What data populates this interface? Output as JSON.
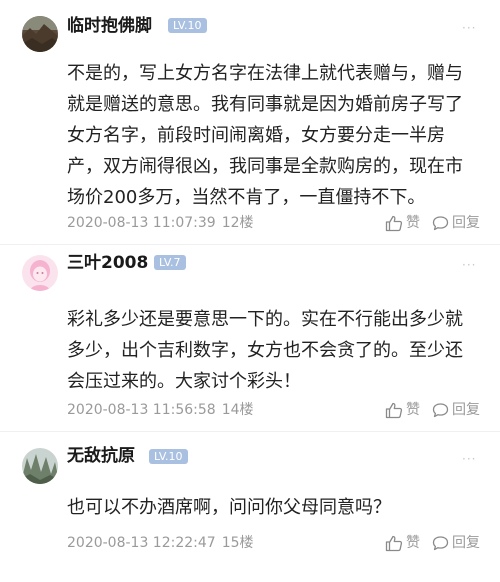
{
  "comments": [
    {
      "username": "临时抱佛脚",
      "level": "LV.10",
      "avatar_icon": "landscape-avatar-icon",
      "lines": [
        "不是的，写上女方名字在法律上就代表赠与，赠与",
        "就是赠送的意思。我有同事就是因为婚前房子写了",
        "女方名字，前段时间闹离婚，女方要分走一半房",
        "产，双方闹得很凶，我同事是全款购房的，现在市",
        "场价200多万，当然不肯了，一直僵持不下。"
      ],
      "time": "2020-08-13 11:07:39",
      "floor": "12楼",
      "like_label": "赞",
      "reply_label": "回复"
    },
    {
      "username": "三叶2008",
      "level": "LV.7",
      "avatar_icon": "pink-cartoon-avatar-icon",
      "lines": [
        "彩礼多少还是要意思一下的。实在不行能出多少就",
        "多少，出个吉利数字，女方也不会贪了的。至少还",
        "会压过来的。大家讨个彩头！"
      ],
      "time": "2020-08-13 11:56:58",
      "floor": "14楼",
      "like_label": "赞",
      "reply_label": "回复"
    },
    {
      "username": "无敌抗原",
      "level": "LV.10",
      "avatar_icon": "mountain-avatar-icon",
      "lines": [
        "也可以不办酒席啊，问问你父母同意吗？"
      ],
      "time": "2020-08-13 12:22:47",
      "floor": "15楼",
      "like_label": "赞",
      "reply_label": "回复"
    }
  ],
  "colors": {
    "level_badge": "#a9c0e0",
    "meta_text": "#9a9a9a",
    "body_text": "#222222"
  }
}
